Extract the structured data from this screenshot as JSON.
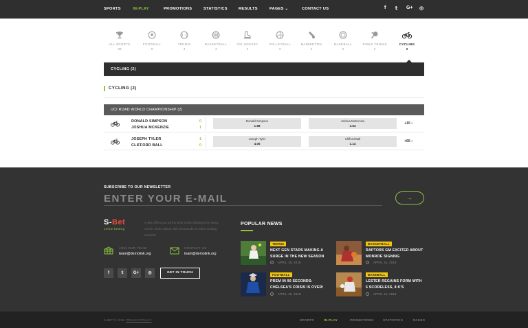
{
  "nav": {
    "items": [
      "SPORTS",
      "IN-PLAY",
      "PROMOTIONS",
      "STATISTICS",
      "RESULTS",
      "PAGES",
      "CONTACT US"
    ],
    "active": "IN-PLAY",
    "pages_caret": "⌄",
    "social": [
      "f",
      "𝕥",
      "G+",
      "◎"
    ]
  },
  "sports_tabs": [
    {
      "label": "ALL SPORTS",
      "count": "29",
      "icon": "trophy-icon"
    },
    {
      "label": "FOOTBALL",
      "count": "6",
      "icon": "football-icon"
    },
    {
      "label": "TENNIS",
      "count": "4",
      "icon": "tennis-icon"
    },
    {
      "label": "BASKETBALL",
      "count": "4",
      "icon": "basketball-icon"
    },
    {
      "label": "ICE HOCKEY",
      "count": "3",
      "icon": "ice-hockey-icon"
    },
    {
      "label": "VOLLEYBALL",
      "count": "3",
      "icon": "volleyball-icon"
    },
    {
      "label": "BADMINTON",
      "count": "4",
      "icon": "badminton-icon"
    },
    {
      "label": "BASEBALL",
      "count": "2",
      "icon": "baseball-icon"
    },
    {
      "label": "TABLE TENNIS",
      "count": "2",
      "icon": "table-tennis-icon"
    },
    {
      "label": "CYCLING",
      "count": "2",
      "icon": "cycling-icon",
      "active": true
    }
  ],
  "bar_title": "CYCLING (2)",
  "section_title": "CYCLING (2)",
  "event_title": "UCI ROAD WORLD CHAMPIONSHIP (2)",
  "matches": [
    {
      "p1": "DONALD SIMPSON",
      "p2": "JOSHUA MCKENZIE",
      "s1": "0",
      "s2": "1",
      "o1_name": "Donald Simpson",
      "o1_value": "1.98",
      "o2_name": "Joshua McKenzie",
      "o2_value": "3.54",
      "more": "+15 ›"
    },
    {
      "p1": "JOSEPH TYLER",
      "p2": "CLIFFORD BALL",
      "s1": "1",
      "s2": "0",
      "o1_name": "Joseph Tyler",
      "o1_value": "4.05",
      "o2_name": "Clifford Ball",
      "o2_value": "1.14",
      "more": "+65 ›"
    }
  ],
  "footer": {
    "newsletter_label": "SUBSCRIBE TO OUR NEWSLETTER",
    "newsletter_placeholder": "ENTER YOUR E-MAIL",
    "newsletter_arrow": "→",
    "logo_main": "S-",
    "logo_accent": "Bet",
    "logo_sub": "online betting",
    "about": "S-Bet offers you all the best online betting from every corner of the planet with thousands of online betting markets.",
    "join_label": "JOIN OUR TEAM",
    "join_email": "team@demolink.org",
    "contact_label": "CONTACT US",
    "contact_email": "team@demolink.org",
    "social": [
      "f",
      "𝕥",
      "G+",
      "◎"
    ],
    "get_in_touch": "GET IN TOUCH",
    "popular_title": "POPULAR NEWS",
    "news": [
      {
        "tag": "TENNIS",
        "title": "NEXT GEN STARS MAKING A SURGE IN THE NEW SEASON",
        "date": "APRIL 15, 2018"
      },
      {
        "tag": "BASKETBALL",
        "title": "RAPTORS GM EXCITED ABOUT MONROE SIGNING",
        "date": "APRIL 15, 2018"
      },
      {
        "tag": "FOOTBALL",
        "title": "PREM IN 90 SECONDS: CHELSEA'S CRISIS IS OVER!",
        "date": "APRIL 15, 2018"
      },
      {
        "tag": "BASEBALL",
        "title": "LESTER REGAINS FORM WITH 6 SCORELESS, 8 K'S",
        "date": "APRIL 15, 2018"
      }
    ],
    "copyright": "S-BET © 2018.",
    "privacy": "PRIVACY POLICY",
    "bottom_nav": [
      "SPORTS",
      "IN-PLAY",
      "PROMOTIONS",
      "STATISTICS",
      "PAGES"
    ],
    "bottom_active": "IN-PLAY"
  },
  "colors": {
    "accent": "#8cc63f",
    "dark": "#2f2f2f",
    "tag": "#f1c40f",
    "logo_red": "#e74c3c"
  }
}
